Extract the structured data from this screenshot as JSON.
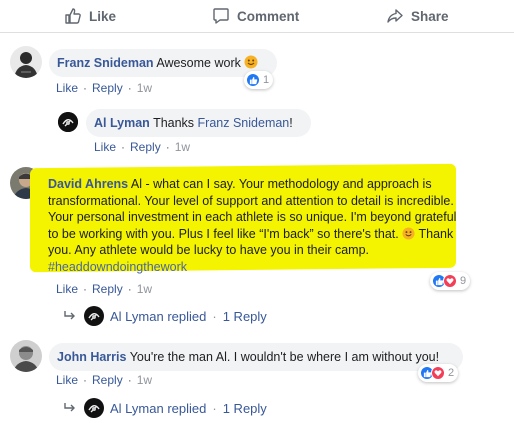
{
  "actions": {
    "like": "Like",
    "comment": "Comment",
    "share": "Share"
  },
  "comments": [
    {
      "author": "Franz Snideman",
      "text": "Awesome work",
      "reaction_count": "1",
      "like": "Like",
      "reply": "Reply",
      "time": "1w",
      "replies": [
        {
          "author": "Al Lyman",
          "text_prefix": "Thanks",
          "mention": "Franz Snideman",
          "text_suffix": "!",
          "like": "Like",
          "reply": "Reply",
          "time": "1w"
        }
      ]
    },
    {
      "author": "David Ahrens",
      "text_1": "Al - what can I say. Your methodology and approach is transformational. Your level of support and attention to detail is incredible. Your personal investment in each athlete is so unique. I'm beyond grateful to be working with you. Plus I feel like “I'm back” so there's that.",
      "text_2": "Thank you. Any athlete would be lucky to have you in their camp.",
      "hashtag": "#headdowndoingthework",
      "reaction_count": "9",
      "like": "Like",
      "reply": "Reply",
      "time": "1w",
      "replied_name": "Al Lyman",
      "replied_word": "replied",
      "replies_label": "1 Reply"
    },
    {
      "author": "John Harris",
      "text": "You're the man Al. I wouldn't be where I am without you!",
      "reaction_count": "2",
      "like": "Like",
      "reply": "Reply",
      "time": "1w",
      "replied_name": "Al Lyman",
      "replied_word": "replied",
      "replies_label": "1 Reply"
    }
  ],
  "colors": {
    "link": "#385898",
    "meta": "#606770",
    "highlight": "#f4f300",
    "bubble": "#f2f3f5"
  }
}
